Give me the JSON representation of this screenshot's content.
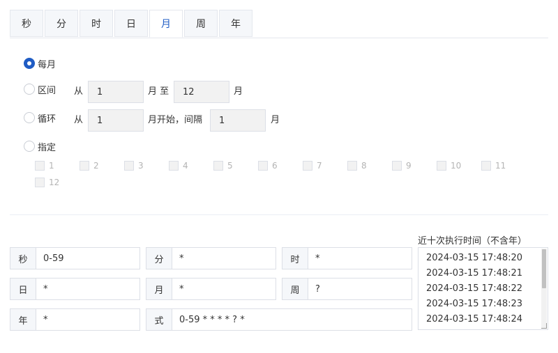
{
  "tabs": [
    {
      "label": "秒"
    },
    {
      "label": "分"
    },
    {
      "label": "时"
    },
    {
      "label": "日"
    },
    {
      "label": "月"
    },
    {
      "label": "周"
    },
    {
      "label": "年"
    }
  ],
  "active_tab": "月",
  "options": {
    "every": {
      "label": "每月",
      "checked": true
    },
    "range": {
      "label": "区间",
      "from": "从",
      "start": "1",
      "mid": "月 至",
      "end": "12",
      "suffix": "月"
    },
    "cycle": {
      "label": "循环",
      "from": "从",
      "start": "1",
      "mid": "月开始，间隔",
      "interval": "1",
      "suffix": "月"
    },
    "specify": {
      "label": "指定",
      "months": [
        "1",
        "2",
        "3",
        "4",
        "5",
        "6",
        "7",
        "8",
        "9",
        "10",
        "11",
        "12"
      ]
    }
  },
  "fields": {
    "second": {
      "label": "秒",
      "value": "0-59"
    },
    "minute": {
      "label": "分",
      "value": "*"
    },
    "hour": {
      "label": "时",
      "value": "*"
    },
    "day": {
      "label": "日",
      "value": "*"
    },
    "month": {
      "label": "月",
      "value": "*"
    },
    "week": {
      "label": "周",
      "value": "?"
    },
    "year": {
      "label": "年",
      "value": "*"
    },
    "expression": {
      "label": "式",
      "value": "0-59 * * * * ? *"
    }
  },
  "run_times": {
    "title": "近十次执行时间（不含年）",
    "items": [
      "2024-03-15 17:48:20",
      "2024-03-15 17:48:21",
      "2024-03-15 17:48:22",
      "2024-03-15 17:48:23",
      "2024-03-15 17:48:24"
    ]
  }
}
